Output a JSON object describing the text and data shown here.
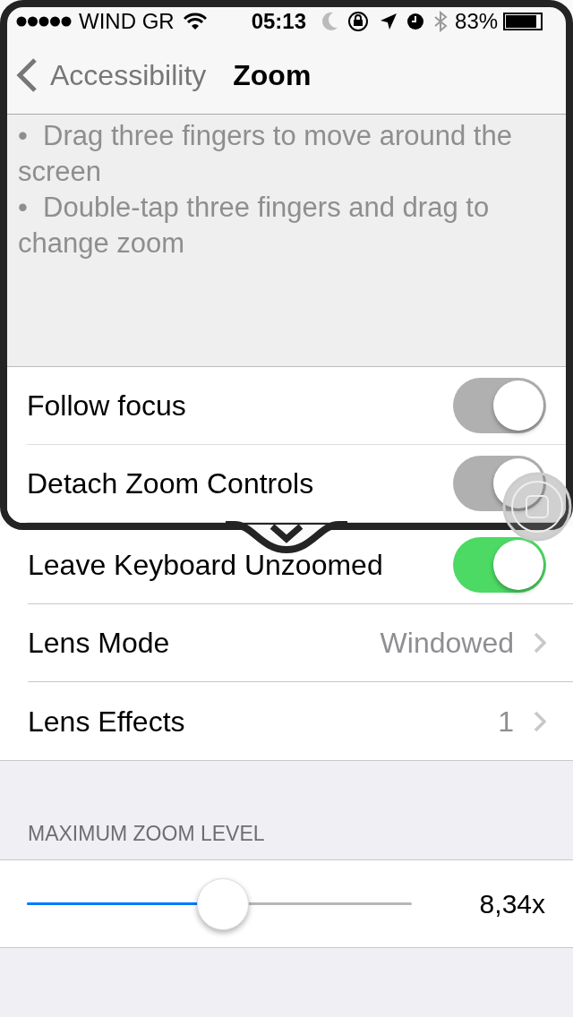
{
  "status_bar": {
    "carrier": "WIND GR",
    "time": "05:13",
    "battery": "83%"
  },
  "nav": {
    "back": "Accessibility",
    "title": "Zoom"
  },
  "description": [
    "•  Drag three fingers to move around the screen",
    "•  Double-tap three fingers and drag to change zoom"
  ],
  "lens_rows": [
    {
      "kind": "toggle",
      "label": "Follow focus",
      "on": false
    },
    {
      "kind": "toggle",
      "label": "Detach Zoom Controls",
      "on": false
    }
  ],
  "rows": [
    {
      "kind": "toggle",
      "label": "Leave Keyboard Unzoomed",
      "on": true
    },
    {
      "kind": "disclosure",
      "label": "Lens Mode",
      "value": "Windowed"
    },
    {
      "kind": "disclosure",
      "label": "Lens Effects",
      "value": "1"
    }
  ],
  "zoom_section": {
    "header": "MAXIMUM ZOOM LEVEL",
    "slider": {
      "level": 0.51,
      "reading": "8,34x"
    }
  }
}
